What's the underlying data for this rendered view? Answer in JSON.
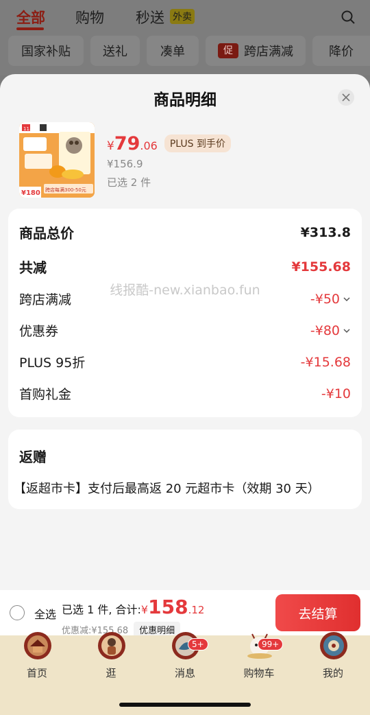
{
  "top_tabs": [
    {
      "label": "全部",
      "active": true
    },
    {
      "label": "购物",
      "active": false
    },
    {
      "label": "秒送",
      "active": false
    }
  ],
  "waimai_badge": "外卖",
  "chips": [
    "国家补贴",
    "送礼",
    "凑单",
    "跨店满减",
    "降价"
  ],
  "chip_promo_tag": "促",
  "sheet": {
    "title": "商品明细",
    "product": {
      "price_currency": "¥",
      "price_int": "79",
      "price_dec": ".06",
      "plus_badge": "PLUS 到手价",
      "orig_price": "¥156.9",
      "selected": "已选 2 件",
      "image_labels": {
        "sale": "11.11",
        "cross_store": "跨店每满300-50元",
        "corner": "¥180"
      }
    },
    "summary": {
      "rows": [
        {
          "label": "商品总价",
          "value": "¥313.8",
          "style": "total"
        },
        {
          "label": "共减",
          "value": "¥155.68",
          "style": "discount_total"
        },
        {
          "label": "跨店满减",
          "value": "-¥50",
          "chevron": true
        },
        {
          "label": "优惠券",
          "value": "-¥80",
          "chevron": true
        },
        {
          "label": "PLUS 95折",
          "value": "-¥15.68",
          "chevron": false
        },
        {
          "label": "首购礼金",
          "value": "-¥10",
          "chevron": false
        }
      ],
      "watermark": "线报酷-new.xianbao.fun"
    },
    "rebate": {
      "title": "返赠",
      "text": "【返超市卡】支付后最高返 20 元超市卡（效期 30 天）"
    }
  },
  "checkout": {
    "select_all": "全选",
    "total_label": "已选 1 件, 合计:",
    "total_currency": "¥",
    "total_int": "158",
    "total_dec": ".12",
    "discount_text": "优惠减:¥155.68",
    "detail_button": "优惠明细",
    "checkout_button": "去结算"
  },
  "bottom_nav": [
    {
      "label": "首页",
      "icon": "home-icon"
    },
    {
      "label": "逛",
      "icon": "browse-icon"
    },
    {
      "label": "消息",
      "icon": "message-icon",
      "badge": "5+"
    },
    {
      "label": "购物车",
      "icon": "cart-icon",
      "badge": "99+"
    },
    {
      "label": "我的",
      "icon": "profile-icon"
    }
  ],
  "colors": {
    "accent_red": "#e4393c",
    "active_tab": "#8c1e14",
    "nav_bg": "#efe4c8"
  }
}
